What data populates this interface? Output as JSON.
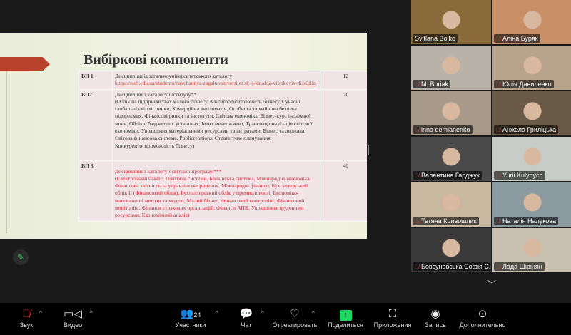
{
  "slide": {
    "title": "Вибіркові компоненти",
    "rows": [
      {
        "code": "ВП 1",
        "lines": [
          "Дисципліни із загальноуніверситетського каталогу"
        ],
        "link": "https://nuft.edu.ua/studentu/navchannya/zagalnouniversitet sk ij-katalog-vibirkovix-disciplin",
        "credits": "12"
      },
      {
        "code": "ВП2",
        "lines": [
          "Дисципліни з каталогу інституту**",
          "(Облік на підприємствах малого бізнесу, Клієнтоорієнтованість бізнесу, Сучасні глобальні світові ринки, Комерційна дипломатія, Особиста та майнова безпека підприємця, Фінансові ринки та інститути, Світова економіка, Бізнес-курс іноземної мови, Облік в бюджетних установах, Івент менеджмент, Транснаціоналізація світової економіки, Управління матеріальними ресурсами та витратами, Бізнес та держава, Світова фінансова система, Publicrelations, Стратегічне планування, Конкурентоспроможність бізнесу)"
        ],
        "credits": "8"
      },
      {
        "code": "ВП 3",
        "lines": [
          "Дисципліни з каталогу освітньої програми***",
          "(Електронний бізнес, Платіжні системи, Банківська система, Міжнародна економіка, Фінансова звітність та управлінське рішення, Міжнародні фінанси, Бухгалтерський облік II (Фінансовий облік), Бухгалтерський облік у промисловості, Економіко- математичні методи та моделі, Малий бізнес, Фінансовий контролінг, Фінансовий моніторінг, Фінанси страхових організацій, Фінанси АПК, Управління трудовими ресурсами, Економічний аналіз)"
        ],
        "credits": "40"
      }
    ]
  },
  "participants": [
    {
      "name": "Svitlana Boiko",
      "muted": false,
      "active": true,
      "color": "#8a6a3a"
    },
    {
      "name": "Аліна Буряк",
      "muted": true,
      "color": "#c99068"
    },
    {
      "name": "M. Buriak",
      "muted": true,
      "color": "#b8b2a8"
    },
    {
      "name": "Юлія Даниленко",
      "muted": true,
      "color": "#b8a48c"
    },
    {
      "name": "inna demianenko",
      "muted": true,
      "color": "#a89a8a"
    },
    {
      "name": "Анжела Гриліцька",
      "muted": true,
      "color": "#6a5a48"
    },
    {
      "name": "Валентина Гарджук",
      "muted": true,
      "color": "#4a4a4a"
    },
    {
      "name": "Yurii Kulynych",
      "muted": true,
      "color": "#c8ccc8"
    },
    {
      "name": "Тетяна  Кривошлик",
      "muted": true,
      "color": "#c8b8a0"
    },
    {
      "name": "Наталія Налукова",
      "muted": true,
      "color": "#8a9aa0"
    },
    {
      "name": "Бовсуновська Софія С...",
      "muted": true,
      "color": "#3a3a3a"
    },
    {
      "name": "Лада Шірінян",
      "muted": true,
      "color": "#c8c0b0"
    }
  ],
  "toolbar": {
    "audio": "Звук",
    "video": "Видео",
    "participants": "Участники",
    "participants_count": "24",
    "chat": "Чат",
    "react": "Отреагировать",
    "share": "Поделиться",
    "apps": "Приложения",
    "record": "Запись",
    "more": "Дополнительно"
  }
}
